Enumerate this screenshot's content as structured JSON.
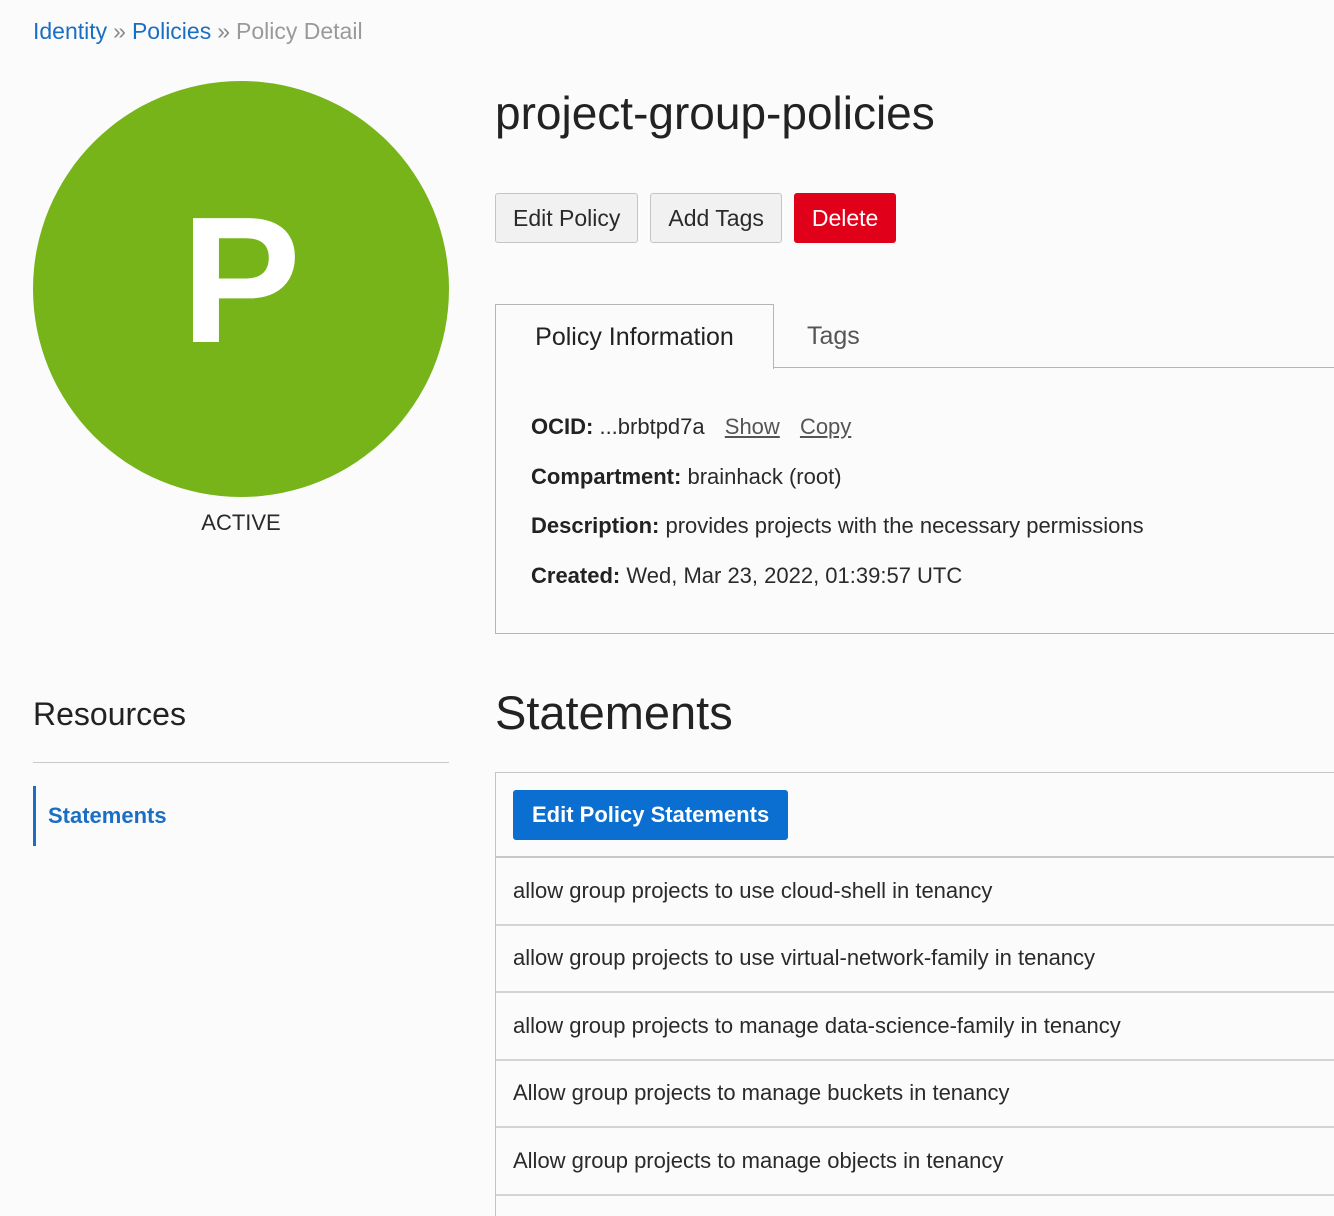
{
  "breadcrumb": {
    "items": [
      "Identity",
      "Policies"
    ],
    "separator": "»",
    "current": "Policy Detail"
  },
  "badge": {
    "letter": "P",
    "status": "ACTIVE",
    "color": "#76b41a"
  },
  "policy": {
    "name": "project-group-policies"
  },
  "actions": {
    "edit_label": "Edit Policy",
    "add_tags_label": "Add Tags",
    "delete_label": "Delete"
  },
  "tabs": [
    {
      "label": "Policy Information",
      "active": true
    },
    {
      "label": "Tags",
      "active": false
    }
  ],
  "info": {
    "ocid_label": "OCID:",
    "ocid_value": "...brbtpd7a",
    "show_label": "Show",
    "copy_label": "Copy",
    "compartment_label": "Compartment:",
    "compartment_value": "brainhack (root)",
    "description_label": "Description:",
    "description_value": "provides projects with the necessary permissions",
    "created_label": "Created:",
    "created_value": "Wed, Mar 23, 2022, 01:39:57 UTC"
  },
  "resources": {
    "title": "Resources",
    "items": [
      "Statements"
    ]
  },
  "statements": {
    "title": "Statements",
    "edit_button_label": "Edit Policy Statements",
    "items": [
      "allow group projects to use cloud-shell in tenancy",
      "allow group projects to use virtual-network-family in tenancy",
      "allow group projects to manage data-science-family in tenancy",
      "Allow group projects to manage buckets in tenancy",
      "Allow group projects to manage objects in tenancy"
    ]
  },
  "colors": {
    "link": "#1a6fc4",
    "danger": "#e0001a",
    "primary": "#0a6fd0"
  }
}
